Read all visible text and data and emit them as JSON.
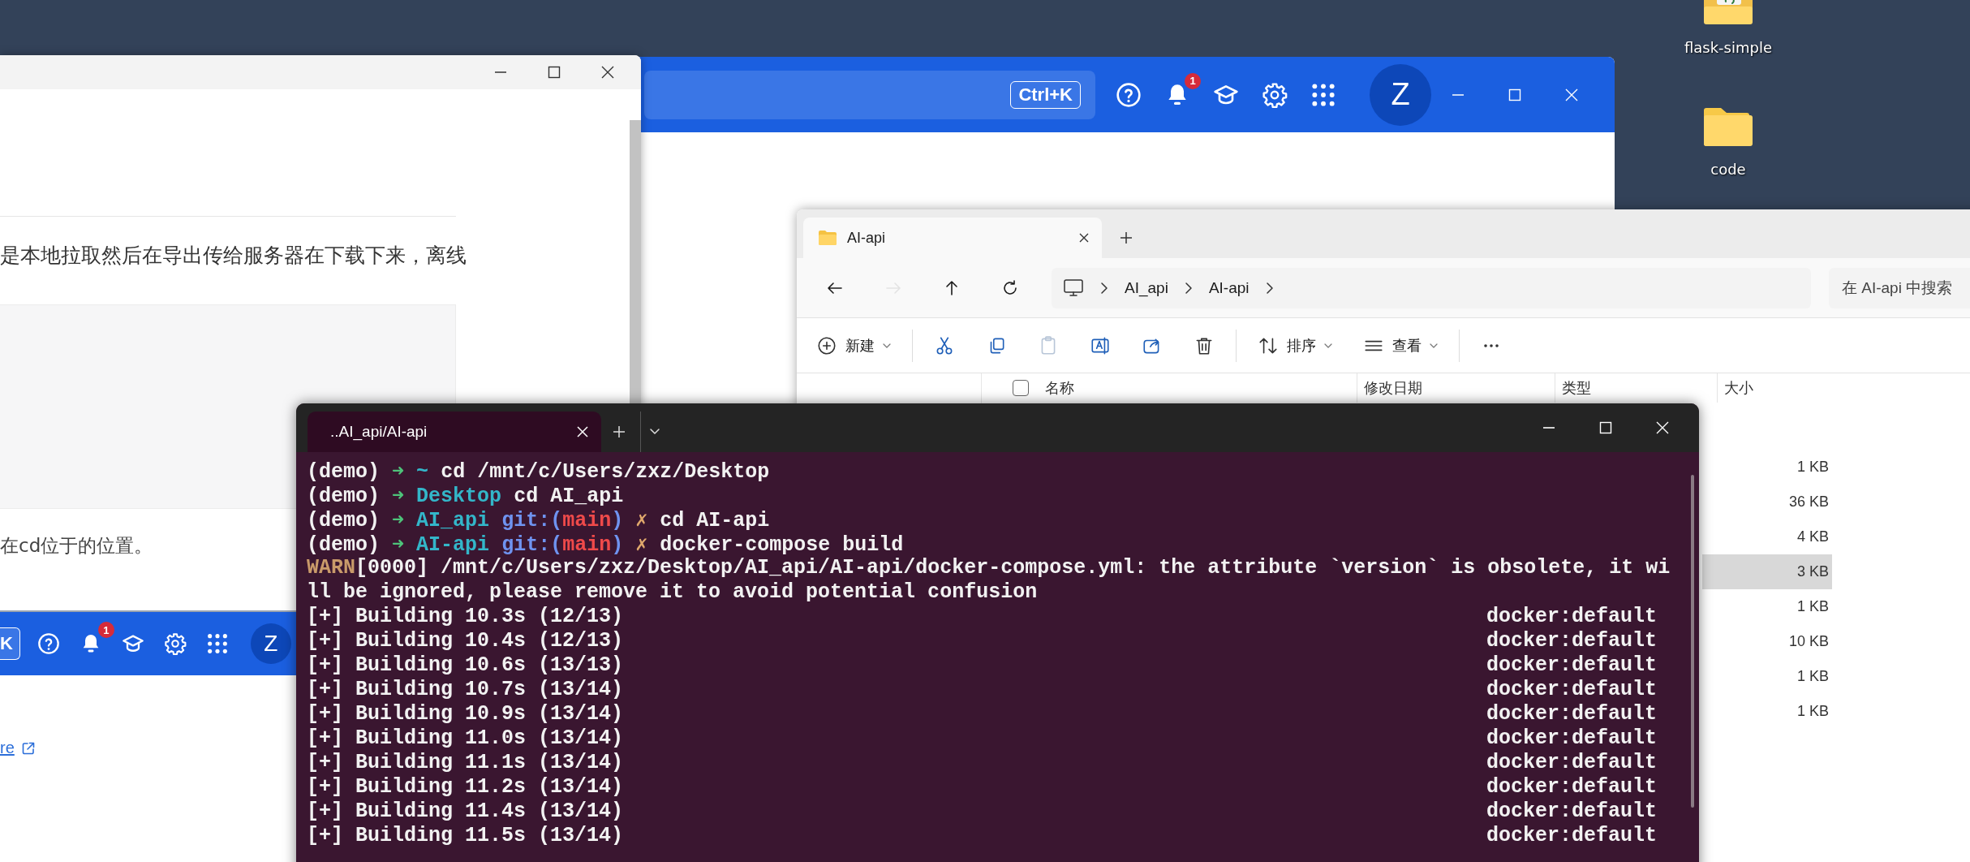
{
  "desktop_icons": [
    {
      "label": "flask-simple",
      "kind": "project-folder"
    },
    {
      "label": "code",
      "kind": "folder"
    }
  ],
  "article_window": {
    "paragraph": "是本地拉取然后在导出传给服务器在下载下来，离线",
    "note": "在cd位于的位置。"
  },
  "second_browser": {
    "shortcut_key": "K",
    "notification_count": "1",
    "avatar_letter": "Z",
    "link": "re"
  },
  "browser_window": {
    "shortcut": "Ctrl+K",
    "notification_count": "1",
    "avatar_letter": "Z"
  },
  "explorer": {
    "tab": "AI-api",
    "nav": [
      {
        "kind": "back",
        "disabled": false
      },
      {
        "kind": "forward",
        "disabled": true
      },
      {
        "kind": "up",
        "disabled": false
      },
      {
        "kind": "refresh",
        "disabled": false
      }
    ],
    "breadcrumb": [
      "AI_api",
      "AI-api"
    ],
    "search": {
      "placeholder": "在 AI-api 中搜索"
    },
    "toolbar": [
      {
        "kind": "new",
        "label": "新建",
        "disabled": false
      },
      {
        "kind": "cut",
        "disabled": false
      },
      {
        "kind": "copy",
        "disabled": false
      },
      {
        "kind": "paste",
        "disabled": true
      },
      {
        "kind": "rename",
        "disabled": false
      },
      {
        "kind": "share",
        "disabled": false
      },
      {
        "kind": "delete",
        "disabled": false
      },
      {
        "kind": "sort",
        "label": "排序",
        "disabled": false
      },
      {
        "kind": "view",
        "label": "查看",
        "disabled": false
      },
      {
        "kind": "more",
        "disabled": false
      }
    ],
    "select_all": {
      "checked": false
    },
    "columns": [
      "名称",
      "修改日期",
      "类型",
      "大小"
    ],
    "files": [
      {
        "size": "1 KB",
        "selected": false
      },
      {
        "size": "36 KB",
        "selected": false
      },
      {
        "size": "4 KB",
        "selected": false
      },
      {
        "size": "3 KB",
        "selected": true
      },
      {
        "size": "1 KB",
        "selected": false
      },
      {
        "size": "10 KB",
        "selected": false
      },
      {
        "size": "1 KB",
        "selected": false
      },
      {
        "size": "1 KB",
        "selected": false
      }
    ]
  },
  "terminal": {
    "tab": "..AI_api/AI-api",
    "lines": [
      {
        "kind": "prompt",
        "env": "(demo)",
        "arrow": "➜",
        "dir": "~",
        "command": "cd /mnt/c/Users/zxz/Desktop"
      },
      {
        "kind": "prompt",
        "env": "(demo)",
        "arrow": "➜",
        "dir": "Desktop",
        "command": "cd AI_api"
      },
      {
        "kind": "prompt",
        "env": "(demo)",
        "arrow": "➜",
        "dir": "AI_api",
        "git_open": "git:(",
        "branch": "main",
        "git_close": ")",
        "dirty": "✗",
        "command": "cd AI-api"
      },
      {
        "kind": "prompt",
        "env": "(demo)",
        "arrow": "➜",
        "dir": "AI-api",
        "git_open": "git:(",
        "branch": "main",
        "git_close": ")",
        "dirty": "✗",
        "command": "docker-compose build"
      },
      {
        "kind": "warn",
        "tag": "WARN",
        "text": "[0000] /mnt/c/Users/zxz/Desktop/AI_api/AI-api/docker-compose.yml: the attribute `version` is obsolete, it wi"
      },
      {
        "kind": "plain",
        "text": "ll be ignored, please remove it to avoid potential confusion"
      },
      {
        "kind": "build",
        "text": "[+] Building 10.3s (12/13)",
        "target": "docker:default"
      },
      {
        "kind": "build",
        "text": "[+] Building 10.4s (12/13)",
        "target": "docker:default"
      },
      {
        "kind": "build",
        "text": "[+] Building 10.6s (13/13)",
        "target": "docker:default"
      },
      {
        "kind": "build",
        "text": "[+] Building 10.7s (13/14)",
        "target": "docker:default"
      },
      {
        "kind": "build",
        "text": "[+] Building 10.9s (13/14)",
        "target": "docker:default"
      },
      {
        "kind": "build",
        "text": "[+] Building 11.0s (13/14)",
        "target": "docker:default"
      },
      {
        "kind": "build",
        "text": "[+] Building 11.1s (13/14)",
        "target": "docker:default"
      },
      {
        "kind": "build",
        "text": "[+] Building 11.2s (13/14)",
        "target": "docker:default"
      },
      {
        "kind": "build",
        "text": "[+] Building 11.4s (13/14)",
        "target": "docker:default"
      },
      {
        "kind": "build",
        "text": "[+] Building 11.5s (13/14)",
        "target": "docker:default"
      }
    ]
  }
}
